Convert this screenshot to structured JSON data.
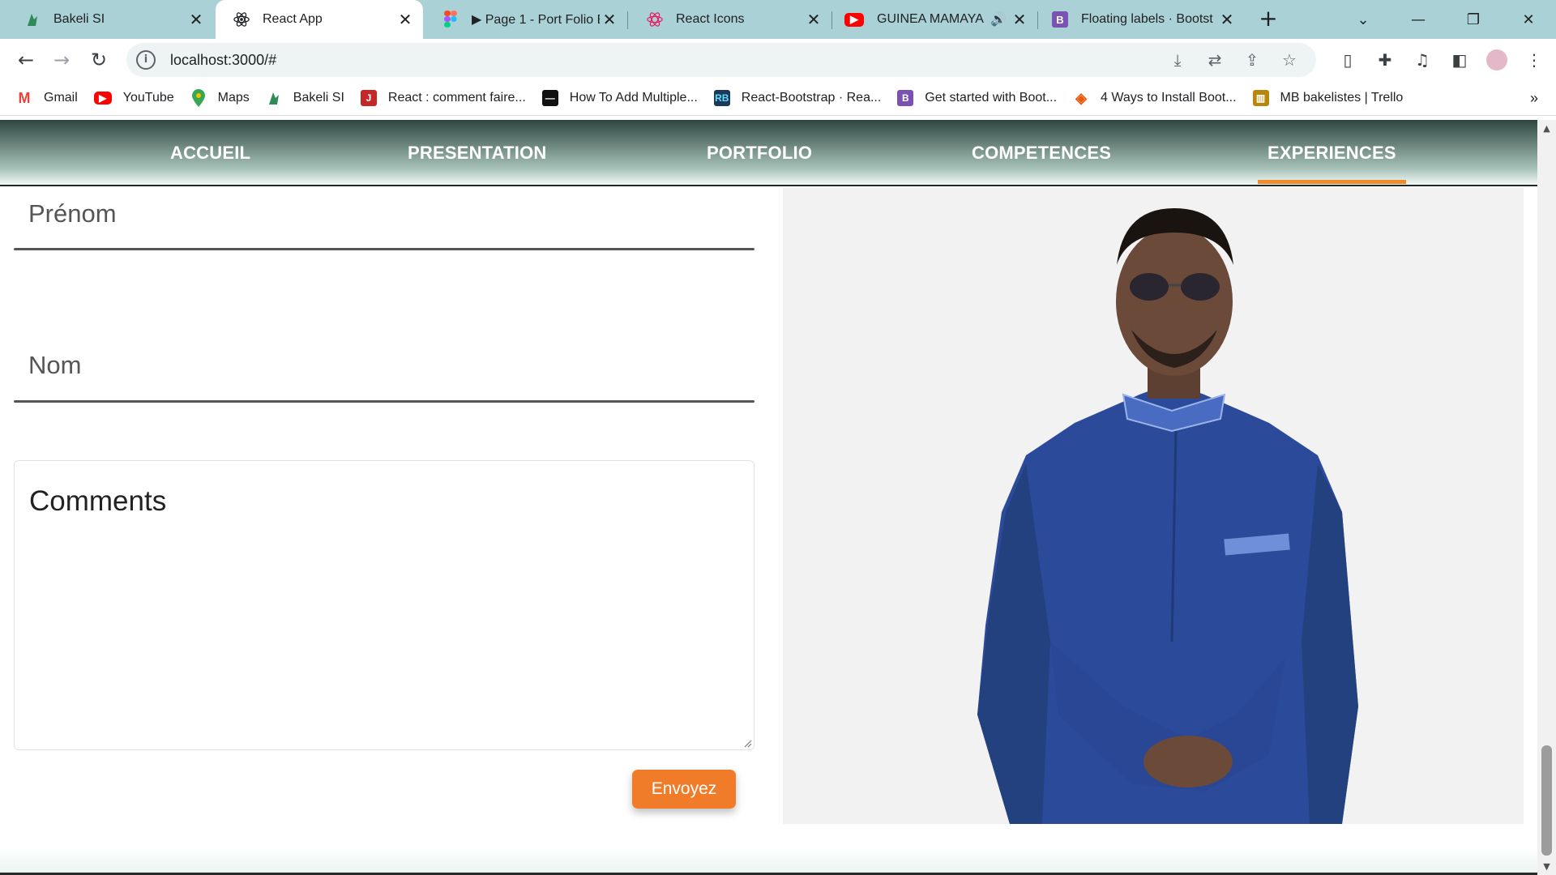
{
  "browser": {
    "tabs": [
      {
        "title": "Bakeli SI",
        "icon": "bakeli-icon",
        "active": false
      },
      {
        "title": "React App",
        "icon": "react-icon",
        "active": true
      },
      {
        "title": "▶ Page 1 - Port Folio B",
        "icon": "figma-icon",
        "active": false
      },
      {
        "title": "React Icons",
        "icon": "react-icons-icon",
        "active": false
      },
      {
        "title": "GUINEA MAMAYA",
        "icon": "youtube-icon",
        "active": false
      },
      {
        "title": "Floating labels · Bootst",
        "icon": "bootstrap-icon",
        "active": false
      }
    ],
    "url": "localhost:3000/#",
    "bookmarks": [
      {
        "label": "Gmail",
        "icon": "gmail-icon"
      },
      {
        "label": "YouTube",
        "icon": "youtube-icon"
      },
      {
        "label": "Maps",
        "icon": "maps-icon"
      },
      {
        "label": "Bakeli SI",
        "icon": "bakeli-icon"
      },
      {
        "label": "React : comment faire...",
        "icon": "j-icon"
      },
      {
        "label": "How To Add Multiple...",
        "icon": "page-icon"
      },
      {
        "label": "React-Bootstrap · Rea...",
        "icon": "react-bootstrap-icon"
      },
      {
        "label": "Get started with Boot...",
        "icon": "bootstrap-icon"
      },
      {
        "label": "4 Ways to Install Boot...",
        "icon": "diamond-icon"
      },
      {
        "label": "MB bakelistes | Trello",
        "icon": "trello-icon"
      }
    ]
  },
  "nav": {
    "items": [
      "ACCUEIL",
      "PRESENTATION",
      "PORTFOLIO",
      "COMPETENCES",
      "EXPERIENCES"
    ],
    "active": "EXPERIENCES"
  },
  "form": {
    "firstname_label": "Prénom",
    "lastname_label": "Nom",
    "comments_label": "Comments",
    "submit_label": "Envoyez"
  },
  "colors": {
    "accent": "#f07c2a",
    "tabstrip": "#aad1d6"
  }
}
